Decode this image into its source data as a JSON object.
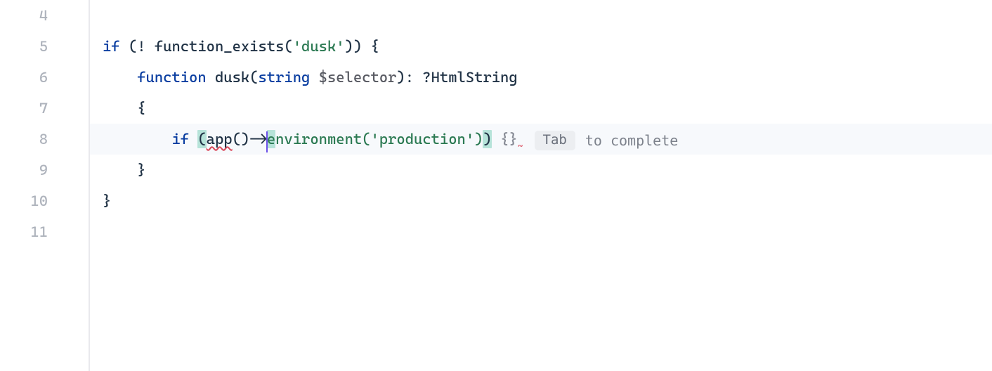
{
  "gutter": {
    "lines": [
      "4",
      "5",
      "6",
      "7",
      "8",
      "9",
      "10",
      "11"
    ]
  },
  "code": {
    "l5": {
      "kw_if": "if",
      "before_fe": " (! ",
      "fe": "function_exists",
      "paren_open": "(",
      "str": "'dusk'",
      "after": ")) {"
    },
    "l6": {
      "indent": "    ",
      "kw_function": "function",
      "sp1": " ",
      "fname": "dusk",
      "paren_open": "(",
      "kw_string": "string",
      "sp2": " ",
      "var": "$selector",
      "after_param": "): ?",
      "ret_type": "HtmlString"
    },
    "l7": {
      "indent": "    ",
      "brace": "{"
    },
    "l8": {
      "indent": "        ",
      "kw_if": "if",
      "sp": " ",
      "lp": "(",
      "app": "app",
      "parens_arrow": "()->",
      "env_e": "e",
      "env_rest": "nvironment",
      "lp2": "(",
      "prod_str": "'production'",
      "rp2": ")",
      "rp": ")",
      "sp2": " ",
      "braces": "{}",
      "hint_key": "Tab",
      "hint_text": "to complete"
    },
    "l9": {
      "indent": "    ",
      "brace": "}"
    },
    "l10": {
      "brace": "}"
    }
  }
}
